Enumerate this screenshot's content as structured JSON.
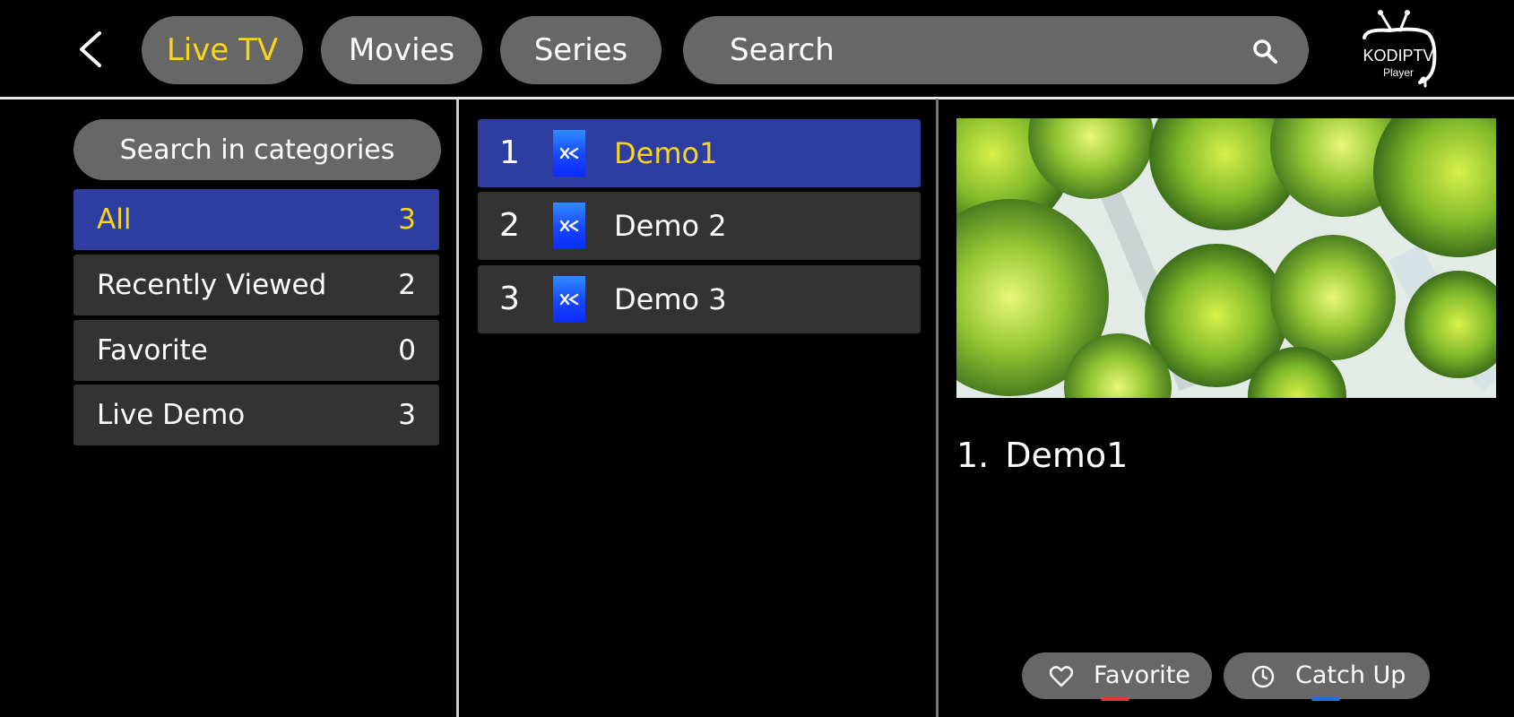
{
  "header": {
    "tabs": [
      {
        "label": "Live TV",
        "active": true
      },
      {
        "label": "Movies",
        "active": false
      },
      {
        "label": "Series",
        "active": false
      }
    ],
    "search_placeholder": "Search",
    "logo": {
      "line1": "KODIPTV",
      "line2": "Player"
    }
  },
  "categories": {
    "search_placeholder": "Search in categories",
    "items": [
      {
        "label": "All",
        "count": "3",
        "selected": true
      },
      {
        "label": "Recently Viewed",
        "count": "2",
        "selected": false
      },
      {
        "label": "Favorite",
        "count": "0",
        "selected": false
      },
      {
        "label": "Live Demo",
        "count": "3",
        "selected": false
      }
    ]
  },
  "channels": [
    {
      "number": "1",
      "name": "Demo1",
      "selected": true
    },
    {
      "number": "2",
      "name": "Demo 2",
      "selected": false
    },
    {
      "number": "3",
      "name": "Demo 3",
      "selected": false
    }
  ],
  "detail": {
    "number": "1.",
    "name": "Demo1"
  },
  "actions": {
    "favorite": {
      "label": "Favorite",
      "color": "#e53935",
      "icon": "heart-icon"
    },
    "catch_up": {
      "label": "Catch Up",
      "color": "#1e6fe0",
      "icon": "clock-icon"
    }
  },
  "colors": {
    "accent_text": "#f7d51c",
    "selected_bg": "#2e3ea0",
    "pill_bg": "#676767",
    "item_bg": "#333333"
  }
}
